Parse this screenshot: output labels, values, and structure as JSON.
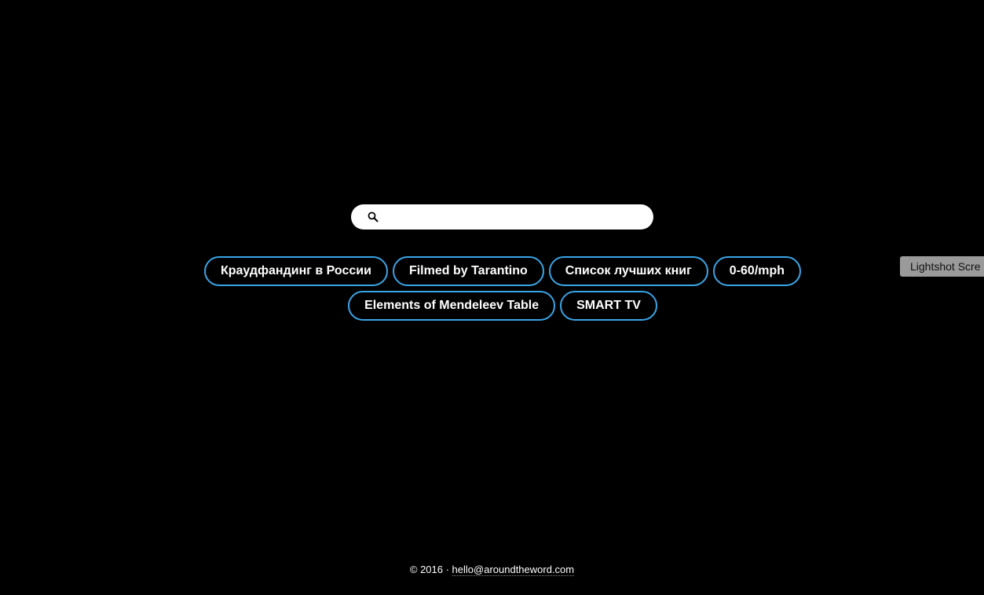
{
  "search": {
    "placeholder": "",
    "value": ""
  },
  "tags": [
    {
      "label": "Краудфандинг в России"
    },
    {
      "label": "Filmed by Tarantino"
    },
    {
      "label": "Список лучших книг"
    },
    {
      "label": "0-60/mph"
    },
    {
      "label": "Elements of Mendeleev Table"
    },
    {
      "label": "SMART TV"
    }
  ],
  "lightshot": {
    "label": "Lightshot Scre"
  },
  "footer": {
    "copyright": "© 2016 · ",
    "email": "hello@aroundtheword.com"
  },
  "colors": {
    "background": "#000000",
    "tag_border": "#3aa4e6",
    "text": "#ffffff"
  }
}
